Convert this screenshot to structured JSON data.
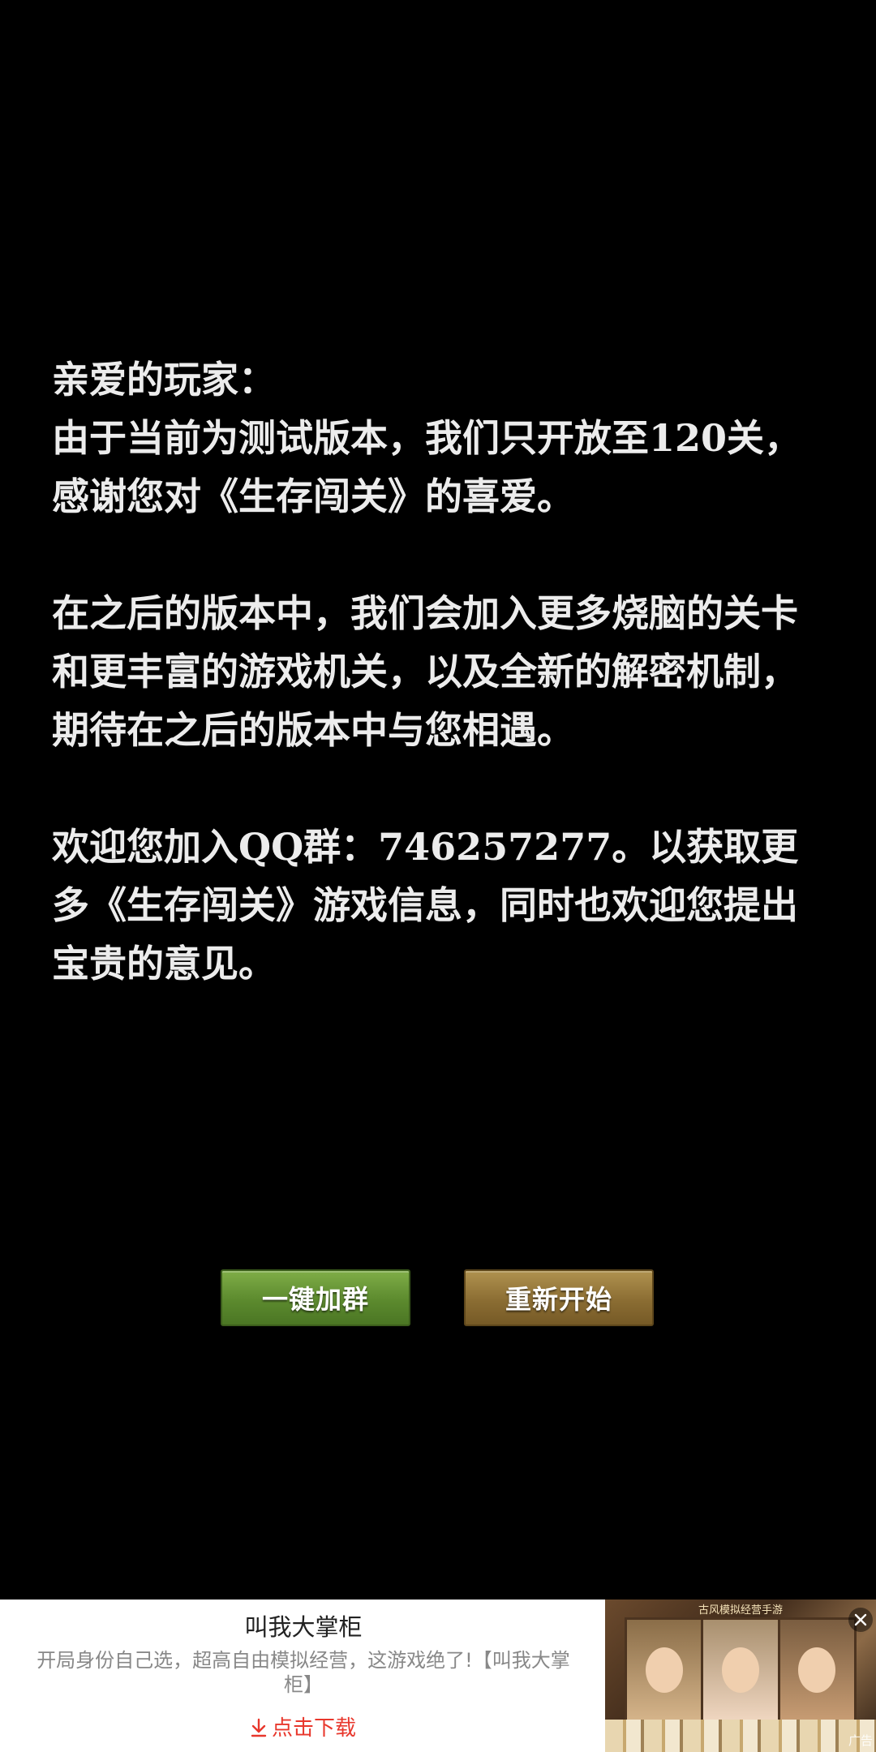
{
  "message": {
    "greeting": "亲爱的玩家：",
    "paragraph1": "由于当前为测试版本，我们只开放至120关，感谢您对《生存闯关》的喜爱。",
    "paragraph2": "在之后的版本中，我们会加入更多烧脑的关卡和更丰富的游戏机关，以及全新的解密机制，期待在之后的版本中与您相遇。",
    "paragraph3": "欢迎您加入QQ群：746257277。以获取更多《生存闯关》游戏信息，同时也欢迎您提出宝贵的意见。"
  },
  "buttons": {
    "join_group": "一键加群",
    "restart": "重新开始"
  },
  "ad": {
    "title": "叫我大掌柜",
    "description": "开局身份自己选，超高自由模拟经营，这游戏绝了!【叫我大掌柜】",
    "download_label": "点击下载",
    "thumbnail_caption": "古风模拟经营手游",
    "badge": "广告",
    "close_icon": "close-icon"
  },
  "colors": {
    "background": "#000000",
    "text": "#ececec",
    "join_button": "#5c8a2e",
    "restart_button": "#8b6d33",
    "download_accent": "#e8372c"
  }
}
